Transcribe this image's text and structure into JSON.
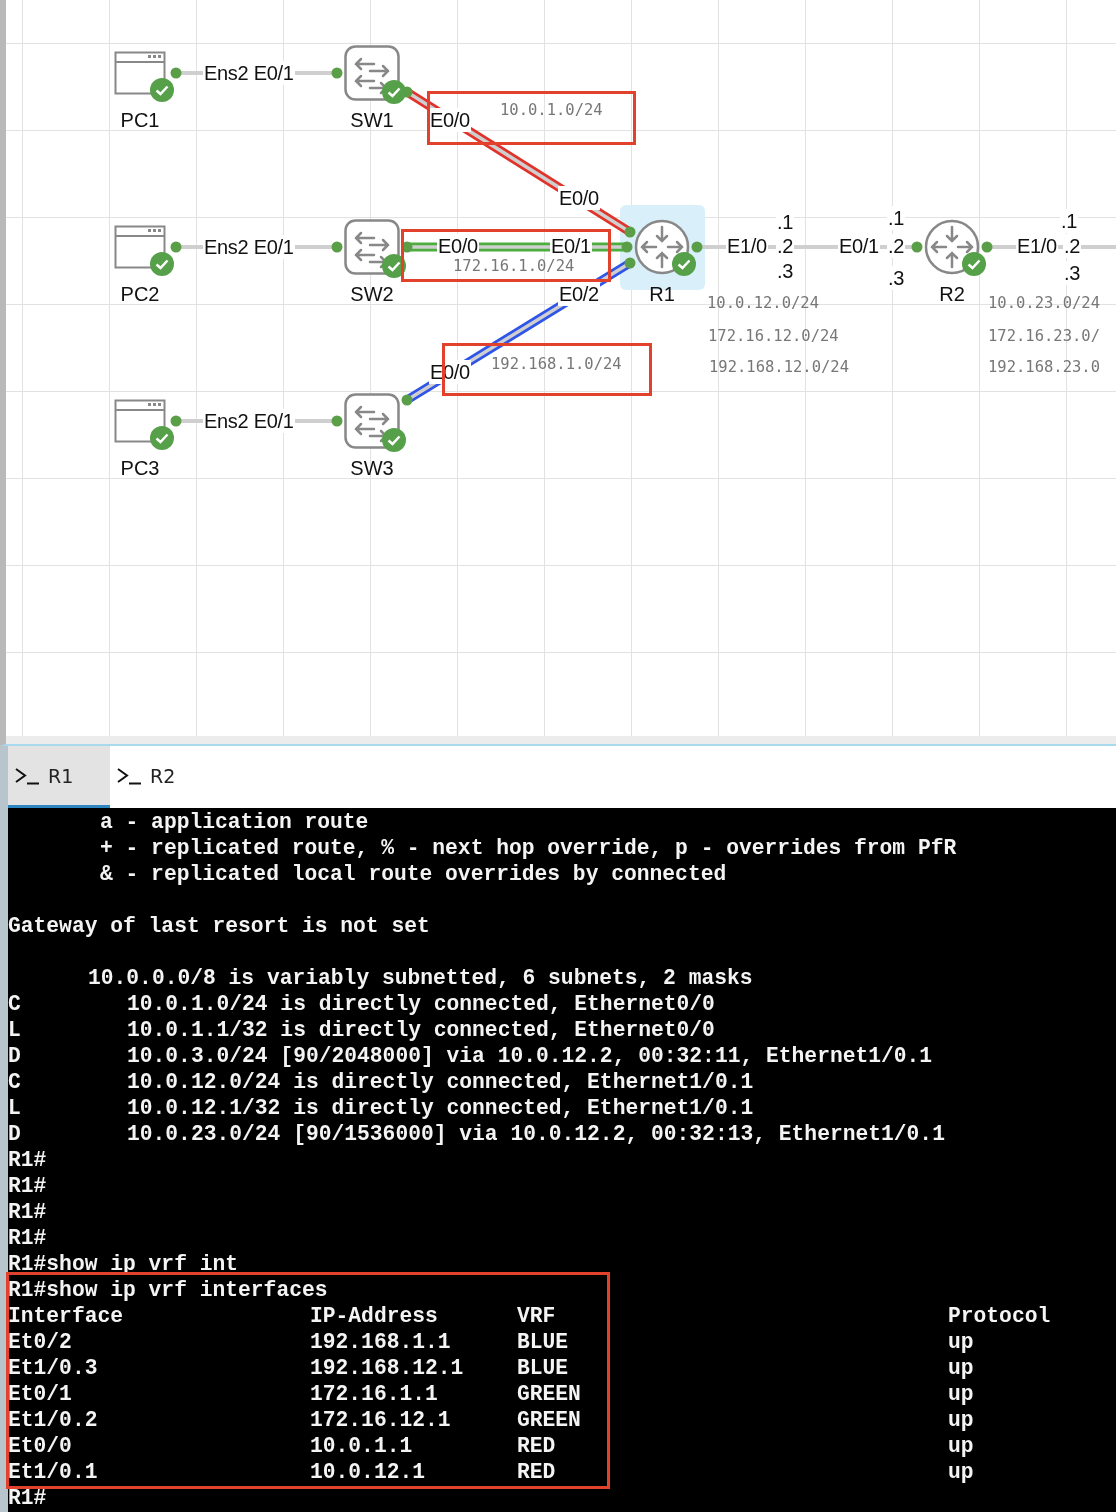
{
  "topology": {
    "nodes": [
      {
        "kind": "pc",
        "label": "PC1",
        "booted": true,
        "selected": false
      },
      {
        "kind": "pc",
        "label": "PC2",
        "booted": true,
        "selected": false
      },
      {
        "kind": "pc",
        "label": "PC3",
        "booted": true,
        "selected": false
      },
      {
        "kind": "switch",
        "label": "SW1",
        "booted": true,
        "selected": false
      },
      {
        "kind": "switch",
        "label": "SW2",
        "booted": true,
        "selected": false
      },
      {
        "kind": "switch",
        "label": "SW3",
        "booted": true,
        "selected": false
      },
      {
        "kind": "router",
        "label": "R1",
        "booted": true,
        "selected": true
      },
      {
        "kind": "router",
        "label": "R2",
        "booted": true,
        "selected": false
      }
    ],
    "vrf_links": [
      {
        "color": "#e0332b"
      },
      {
        "color": "#4cae3c"
      },
      {
        "color": "#2f54e8"
      }
    ],
    "interface_labels": [
      "Ens2 E0/1",
      "Ens2 E0/1",
      "Ens2 E0/1",
      "E0/0",
      "E0/0",
      "E0/0",
      "E0/1",
      "E0/2",
      "E0/0",
      "E1/0",
      ".1",
      ".2",
      ".3",
      "E0/1",
      ".1",
      ".2",
      ".3",
      "E1/0",
      ".1",
      ".2",
      ".3"
    ],
    "subnet_labels": [
      "10.0.1.0/24",
      "172.16.1.0/24",
      "192.168.1.0/24",
      "10.0.12.0/24",
      "172.16.12.0/24",
      "192.168.12.0/24",
      "10.0.23.0/24",
      "172.16.23.0/",
      "192.168.23.0"
    ]
  },
  "tabs": [
    {
      "label": "R1",
      "selected": true
    },
    {
      "label": "R2",
      "selected": false
    }
  ],
  "terminal": {
    "lines_before": [
      {
        "kind": "legend",
        "text": "a - application route"
      },
      {
        "kind": "legend",
        "text": "+ - replicated route, % - next hop override, p - overrides from PfR"
      },
      {
        "kind": "legend",
        "text": "& - replicated local route overrides by connected"
      },
      {
        "kind": "blank"
      },
      {
        "kind": "text",
        "text": "Gateway of last resort is not set"
      },
      {
        "kind": "blank"
      },
      {
        "kind": "summary",
        "text": "10.0.0.0/8 is variably subnetted, 6 subnets, 2 masks"
      },
      {
        "kind": "route",
        "code": "C",
        "text": "10.0.1.0/24 is directly connected, Ethernet0/0"
      },
      {
        "kind": "route",
        "code": "L",
        "text": "10.0.1.1/32 is directly connected, Ethernet0/0"
      },
      {
        "kind": "route",
        "code": "D",
        "text": "10.0.3.0/24 [90/2048000] via 10.0.12.2, 00:32:11, Ethernet1/0.1"
      },
      {
        "kind": "route",
        "code": "C",
        "text": "10.0.12.0/24 is directly connected, Ethernet1/0.1"
      },
      {
        "kind": "route",
        "code": "L",
        "text": "10.0.12.1/32 is directly connected, Ethernet1/0.1"
      },
      {
        "kind": "route",
        "code": "D",
        "text": "10.0.23.0/24 [90/1536000] via 10.0.12.2, 00:32:13, Ethernet1/0.1"
      },
      {
        "kind": "text",
        "text": "R1#"
      },
      {
        "kind": "text",
        "text": "R1#"
      },
      {
        "kind": "text",
        "text": "R1#"
      },
      {
        "kind": "text",
        "text": "R1#"
      },
      {
        "kind": "text",
        "text": "R1#show ip vrf int"
      }
    ],
    "vrf_output": {
      "command": "R1#show ip vrf interfaces",
      "columns": [
        "Interface",
        "IP-Address",
        "VRF",
        "Protocol"
      ],
      "rows": [
        [
          "Et0/2",
          "192.168.1.1",
          "BLUE",
          "up"
        ],
        [
          "Et1/0.3",
          "192.168.12.1",
          "BLUE",
          "up"
        ],
        [
          "Et0/1",
          "172.16.1.1",
          "GREEN",
          "up"
        ],
        [
          "Et1/0.2",
          "172.16.12.1",
          "GREEN",
          "up"
        ],
        [
          "Et0/0",
          "10.0.1.1",
          "RED",
          "up"
        ],
        [
          "Et1/0.1",
          "10.0.12.1",
          "RED",
          "up"
        ]
      ]
    },
    "lines_after": [
      {
        "kind": "text",
        "text": "R1#"
      }
    ]
  }
}
